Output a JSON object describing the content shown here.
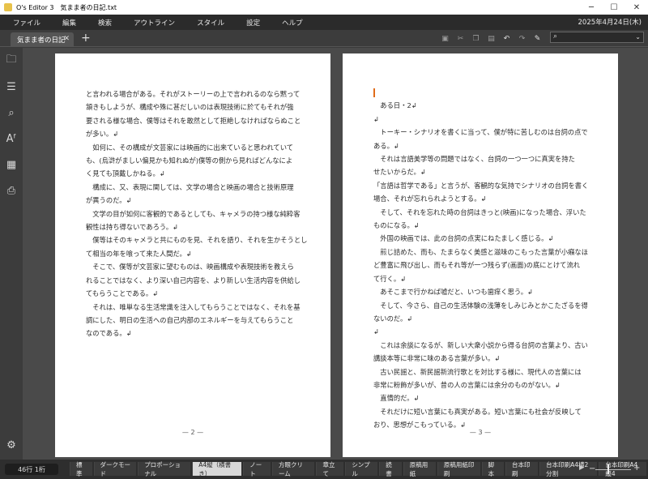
{
  "window": {
    "title": "O's Editor 3　気まま者の日記.txt"
  },
  "menu": {
    "items": [
      "ファイル",
      "編集",
      "検索",
      "アウトライン",
      "スタイル",
      "設定",
      "ヘルプ"
    ],
    "date": "2025年4月24日(木)"
  },
  "tab": {
    "label": "気まま者の日記"
  },
  "sidebar_icons": [
    "folder-icon",
    "outline-list-icon",
    "search-icon",
    "font-icon",
    "document-style-icon",
    "print-icon",
    "settings-icon"
  ],
  "pages": [
    {
      "number": "— 2 —",
      "lines": [
        "と言われる場合がある。それがストーリーの上で言われるのなら黙って",
        "頷きもしようが、構成や殊に甚だしいのは表現技術に於てもそれが強",
        "要される様な場合、僕等はそれを敢然として拒絶しなければならぬこと",
        "が多い。↲",
        "　如何に、その構成が文芸家には映画的に出来ていると思われていて",
        "も、(烏滸がましい偏見かも知れぬが)僕等の側から見ればどんなによ",
        "く見ても頂戴しかねる。↲",
        "　構成に、又、表現に関しては、文学の場合と映画の場合と技術原理",
        "が異うのだ。↲",
        "　文学の目が如何に客観的であるとしても、キャメラの持つ様な純粋客",
        "観性は持ち得ないであろう。↲",
        "　僕等はそのキャメラと共にものを見、それを語り、それを生かそうとし",
        "て相当の年を喰って来た人間だ。↲",
        "　そこで、僕等が文芸家に望むものは、映画構成や表現技術を教えら",
        "れることではなく、より深い自己内容を、より新しい生活内容を供給し",
        "てもらうことである。↲",
        "　それは、唯単なる生活常識を注入してもらうことではなく、それを基",
        "調にした、明日の生活への自己内部のエネルギーを与えてもらうこと",
        "なのである。↲"
      ]
    },
    {
      "number": "— 3 —",
      "lines": [
        "",
        "　ある日・2↲",
        "↲",
        "　トーキー・シナリオを書くに当って、僕が特に苦しむのは台詞の点で",
        "ある。↲",
        "　それは言語美学等の問題ではなく、台詞の一つ一つに真実を持た",
        "せたいからだ。↲",
        "「言語は哲学である」と言うが、客観的な気持でシナリオの台詞を書く",
        "場合、それが忘れられようとする。↲",
        "　そして、それを忘れた時の台詞はきっと(映画)になった場合、浮いた",
        "ものになる。↲",
        "　外国の映画では、此の台詞の点実にねたましく感じる。↲",
        "　煎じ詰めた、而も、たまらなく美感と滋味のこもった言葉が小癪なほ",
        "ど豊富に飛び出し、而もそれ等が一つ残らず(画面)の底にとけて流れ",
        "て行く。↲",
        "　あそこまで行かねば嘘だと、いつも歯痒く思う。↲",
        "　そして、今さら、自己の生活体験の浅薄をしみじみとかこたざるを得",
        "ないのだ。↲",
        "↲",
        "　これは余談になるが、新しい大衆小説から得る台詞の言葉より、古い",
        "講談本等に非常に味のある言葉が多い。↲",
        "　古い民謡と、新民謡新流行歌とを対比する様に、現代人の言葉には",
        "非常に粉飾が多いが、昔の人の言葉には余分のものがない。↲",
        "　直情的だ。↲",
        "　それだけに短い言葉にも真実がある。短い言葉にも社会が反映して",
        "おり、思想がこもっている。↲"
      ]
    }
  ],
  "status": {
    "position": "46行 1桁",
    "style_tabs": [
      "標準",
      "ダークモード",
      "プロポーショナル",
      "A4縦（横書き）",
      "ノート",
      "方眼クリーム",
      "章立て",
      "シンプル",
      "読書",
      "原稿用紙",
      "原稿用紙印刷",
      "脚本",
      "台本印刷",
      "台本印刷A4横2分割",
      "台本印刷A4縦4"
    ],
    "active_style": "A4縦（横書き）"
  }
}
